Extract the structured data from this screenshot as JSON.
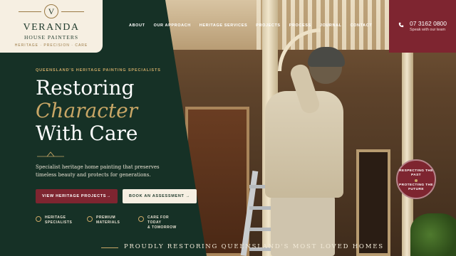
{
  "brand": {
    "initial": "V",
    "name": "VERANDA",
    "sub": "HOUSE PAINTERS",
    "tagline": "HERITAGE  ·  PRECISION  ·  CARE"
  },
  "nav": {
    "items": [
      "ABOUT",
      "OUR APPROACH",
      "HERITAGE SERVICES",
      "PROJECTS",
      "PROCESS",
      "JOURNAL",
      "CONTACT"
    ]
  },
  "contact": {
    "phone": "07 3162 0800",
    "label": "Speak with our team"
  },
  "hero": {
    "eyebrow": "QUEENSLAND'S HERITAGE PAINTING SPECIALISTS",
    "line1": "Restoring",
    "line2": "Character",
    "line3": "With Care",
    "lead": "Specialist heritage home painting that preserves timeless beauty and protects for generations.",
    "cta_primary": "VIEW HERITAGE PROJECTS",
    "cta_secondary": "BOOK AN ASSESSMENT",
    "arrow": "→"
  },
  "features": [
    {
      "icon": "shield-icon",
      "line1": "HERITAGE",
      "line2": "SPECIALISTS"
    },
    {
      "icon": "check-circle-icon",
      "line1": "PREMIUM",
      "line2": "MATERIALS"
    },
    {
      "icon": "leaf-icon",
      "line1": "CARE FOR TODAY",
      "line2": "& TOMORROW"
    }
  ],
  "badge": {
    "top": "RESPECTING THE PAST",
    "bottom": "PROTECTING THE FUTURE"
  },
  "strip": {
    "text": "PROUDLY RESTORING QUEENSLAND'S MOST LOVED HOMES"
  },
  "colors": {
    "forest": "#163126",
    "gold": "#c9a766",
    "burgundy": "#7e2530",
    "cream": "#f6efe2"
  }
}
